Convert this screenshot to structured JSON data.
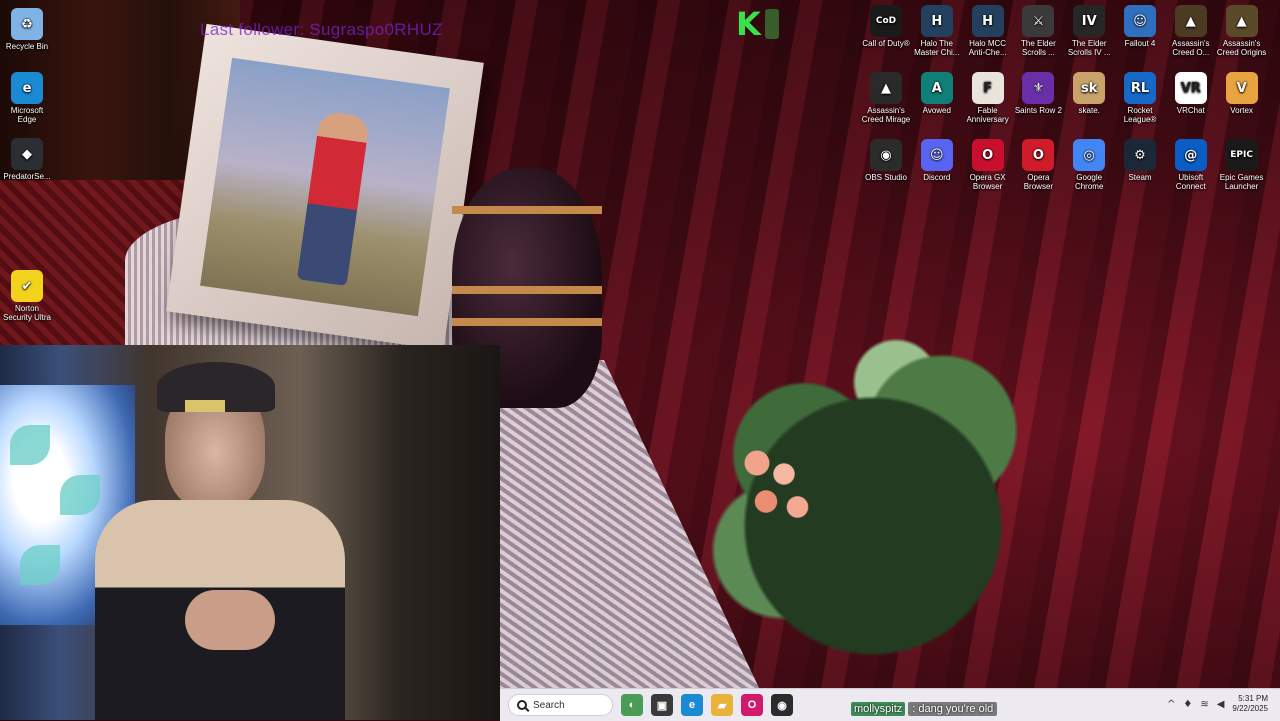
{
  "overlay": {
    "last_follower": "Last follower: Sugraspo0RHUZ"
  },
  "desktop_icons_left": [
    {
      "id": "recycle-bin",
      "label": "Recycle Bin",
      "icon": "recycle-bin-icon",
      "color": "#7fb3e6",
      "glyph": "♻"
    },
    {
      "id": "edge",
      "label": "Microsoft Edge",
      "icon": "edge-icon",
      "color": "#1a8ad3",
      "glyph": "e"
    },
    {
      "id": "predator",
      "label": "PredatorSe...",
      "icon": "predator-sense-icon",
      "color": "#2b2f33",
      "glyph": "◆"
    },
    {
      "id": "norton",
      "label": "Norton Security Ultra",
      "icon": "norton-icon",
      "color": "#f2d21c",
      "glyph": "✔"
    }
  ],
  "desktop_icons_grid": [
    {
      "id": "cod",
      "label": "Call of Duty®",
      "icon": "call-of-duty-icon",
      "color": "#1a1a1a",
      "glyph": "CoD"
    },
    {
      "id": "halo-mcc-1",
      "label": "Halo The Master Chi...",
      "icon": "halo-icon",
      "color": "#23405e",
      "glyph": "H"
    },
    {
      "id": "halo-mcc-2",
      "label": "Halo MCC Anti-Che...",
      "icon": "halo-anticheat-icon",
      "color": "#23405e",
      "glyph": "H"
    },
    {
      "id": "skyrim",
      "label": "The Elder Scrolls ...",
      "icon": "elder-scrolls-icon",
      "color": "#3a3a3a",
      "glyph": "⚔"
    },
    {
      "id": "oblivion",
      "label": "The Elder Scrolls IV ...",
      "icon": "oblivion-icon",
      "color": "#262626",
      "glyph": "IV"
    },
    {
      "id": "fallout4",
      "label": "Fallout 4",
      "icon": "fallout-icon",
      "color": "#2f6fbf",
      "glyph": "☺"
    },
    {
      "id": "ac-odyssey",
      "label": "Assassin's Creed O...",
      "icon": "assassins-creed-icon",
      "color": "#4a3b22",
      "glyph": "▲"
    },
    {
      "id": "ac-origins",
      "label": "Assassin's Creed Origins",
      "icon": "assassins-creed-origins-icon",
      "color": "#5a4a2a",
      "glyph": "▲"
    },
    {
      "id": "ac-mirage",
      "label": "Assassin's Creed Mirage",
      "icon": "assassins-creed-mirage-icon",
      "color": "#2a2a2a",
      "glyph": "▲"
    },
    {
      "id": "avowed",
      "label": "Avowed",
      "icon": "avowed-icon",
      "color": "#0f7f7a",
      "glyph": "A"
    },
    {
      "id": "fable",
      "label": "Fable Anniversary",
      "icon": "fable-icon",
      "color": "#e9e4dc",
      "glyph": "F"
    },
    {
      "id": "saints-row",
      "label": "Saints Row 2",
      "icon": "saints-row-icon",
      "color": "#6a2fa8",
      "glyph": "⚜"
    },
    {
      "id": "skate",
      "label": "skate.",
      "icon": "skate-icon",
      "color": "#caa36a",
      "glyph": "sk"
    },
    {
      "id": "rocket-league",
      "label": "Rocket League®",
      "icon": "rocket-league-icon",
      "color": "#1769c9",
      "glyph": "RL"
    },
    {
      "id": "vrchat",
      "label": "VRChat",
      "icon": "vrchat-icon",
      "color": "#ffffff",
      "glyph": "VR"
    },
    {
      "id": "vortex",
      "label": "Vortex",
      "icon": "vortex-icon",
      "color": "#e7a440",
      "glyph": "V"
    },
    {
      "id": "obs",
      "label": "OBS Studio",
      "icon": "obs-icon",
      "color": "#2b2b2b",
      "glyph": "◉"
    },
    {
      "id": "discord",
      "label": "Discord",
      "icon": "discord-icon",
      "color": "#5865f2",
      "glyph": "☺"
    },
    {
      "id": "opera-gx",
      "label": "Opera GX Browser",
      "icon": "opera-gx-icon",
      "color": "#c8102e",
      "glyph": "O"
    },
    {
      "id": "opera",
      "label": "Opera Browser",
      "icon": "opera-icon",
      "color": "#d01c2a",
      "glyph": "O"
    },
    {
      "id": "chrome",
      "label": "Google Chrome",
      "icon": "chrome-icon",
      "color": "#4285f4",
      "glyph": "◎"
    },
    {
      "id": "steam",
      "label": "Steam",
      "icon": "steam-icon",
      "color": "#1b2838",
      "glyph": "⚙"
    },
    {
      "id": "ubisoft",
      "label": "Ubisoft Connect",
      "icon": "ubisoft-icon",
      "color": "#0b5dc6",
      "glyph": "@"
    },
    {
      "id": "epic",
      "label": "Epic Games Launcher",
      "icon": "epic-games-icon",
      "color": "#1a1a1a",
      "glyph": "EPIC"
    }
  ],
  "taskbar": {
    "search_placeholder": "Search",
    "apps": [
      {
        "id": "widgets",
        "icon": "widgets-icon",
        "color": "#4a9b55",
        "glyph": "◐"
      },
      {
        "id": "task-view",
        "icon": "task-view-icon",
        "color": "#3a3a3a",
        "glyph": "▣"
      },
      {
        "id": "edge",
        "icon": "edge-icon",
        "color": "#1a8ad3",
        "glyph": "e"
      },
      {
        "id": "explorer",
        "icon": "file-explorer-icon",
        "color": "#e9b23a",
        "glyph": "▰"
      },
      {
        "id": "opera-gx",
        "icon": "opera-gx-icon",
        "color": "#d11a6e",
        "glyph": "O"
      },
      {
        "id": "obs",
        "icon": "obs-icon",
        "color": "#2b2b2b",
        "glyph": "◉"
      }
    ]
  },
  "chat": {
    "username": "mollyspitz",
    "message": ": dang you're old"
  },
  "tray": {
    "time": "5:31 PM",
    "date": "9/22/2025"
  }
}
